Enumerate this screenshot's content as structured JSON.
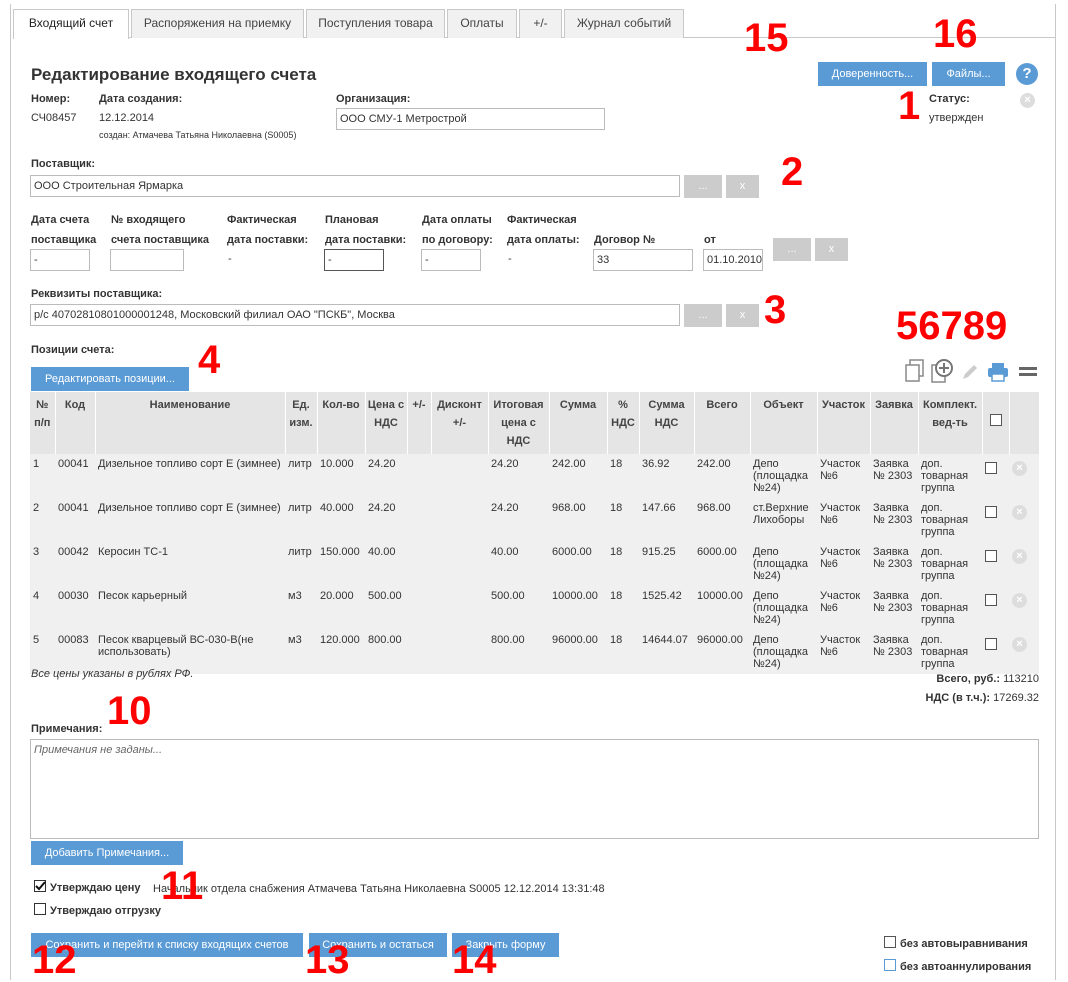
{
  "tabs": [
    "Входящий счет",
    "Распоряжения на приемку",
    "Поступления товара",
    "Оплаты",
    "+/-",
    "Журнал событий"
  ],
  "page_title": "Редактирование входящего счета",
  "header_buttons": {
    "proxy": "Доверенность...",
    "files": "Файлы...",
    "help": "?"
  },
  "header": {
    "number_label": "Номер:",
    "number": "СЧ08457",
    "created_label": "Дата создания:",
    "created": "12.12.2014",
    "created_by": "создан: Атмачева Татьяна Николаевна (S0005)",
    "org_label": "Организация:",
    "org": "ООО СМУ-1 Метрострой",
    "status_label": "Статус:",
    "status": "утвержден"
  },
  "supplier": {
    "label": "Поставщик:",
    "value": "ООО Строительная Ярмарка",
    "pick": "...",
    "clear": "x"
  },
  "dates": {
    "supplier_date_l1": "Дата счета",
    "supplier_date_l2": "поставщика",
    "supplier_date": "-",
    "incoming_no_l1": "№ входящего",
    "incoming_no_l2": "счета поставщика",
    "incoming_no": "",
    "fact_delivery_l1": "Фактическая",
    "fact_delivery_l2": "дата поставки:",
    "fact_delivery": "-",
    "plan_delivery_l1": "Плановая",
    "plan_delivery_l2": "дата поставки:",
    "plan_delivery": "-",
    "pay_contract_l1": "Дата оплаты",
    "pay_contract_l2": "по договору:",
    "pay_contract": "-",
    "fact_pay_l1": "Фактическая",
    "fact_pay_l2": "дата оплаты:",
    "fact_pay": "-",
    "contract_label": "Договор №",
    "contract": "33",
    "from_label": "от",
    "from": "01.10.2010",
    "pick": "...",
    "clear": "x"
  },
  "requisites": {
    "label": "Реквизиты поставщика:",
    "value": "р/с 40702810801000001248, Московский филиал ОАО \"ПСКБ\", Москва",
    "pick": "...",
    "clear": "x"
  },
  "positions_label": "Позиции счета:",
  "edit_positions": "Редактировать позиции...",
  "table_headers": [
    "№ п/п",
    "Код",
    "Наименование",
    "Ед. изм.",
    "Кол-во",
    "Цена с НДС",
    "+/-",
    "Дисконт +/-",
    "Итоговая цена с НДС",
    "Сумма",
    "% НДС",
    "Сумма НДС",
    "Всего",
    "Объект",
    "Участок",
    "Заявка",
    "Комплект. вед-ть"
  ],
  "rows": [
    {
      "n": "1",
      "code": "00041",
      "name": "Дизельное топливо сорт Е (зимнее)",
      "unit": "литр",
      "qty": "10.000",
      "price": "24.20",
      "pm": "",
      "disc": "",
      "final": "24.20",
      "sum": "242.00",
      "vat_pct": "18",
      "vat_sum": "36.92",
      "total": "242.00",
      "object": "Депо (площадка №24)",
      "site": "Участок №6",
      "req": "Заявка № 2303",
      "kit": "доп. товарная группа"
    },
    {
      "n": "2",
      "code": "00041",
      "name": "Дизельное топливо сорт Е (зимнее)",
      "unit": "литр",
      "qty": "40.000",
      "price": "24.20",
      "pm": "",
      "disc": "",
      "final": "24.20",
      "sum": "968.00",
      "vat_pct": "18",
      "vat_sum": "147.66",
      "total": "968.00",
      "object": "ст.Верхние Лихоборы",
      "site": "Участок №6",
      "req": "Заявка № 2303",
      "kit": "доп. товарная группа"
    },
    {
      "n": "3",
      "code": "00042",
      "name": "Керосин ТС-1",
      "unit": "литр",
      "qty": "150.000",
      "price": "40.00",
      "pm": "",
      "disc": "",
      "final": "40.00",
      "sum": "6000.00",
      "vat_pct": "18",
      "vat_sum": "915.25",
      "total": "6000.00",
      "object": "Депо (площадка №24)",
      "site": "Участок №6",
      "req": "Заявка № 2303",
      "kit": "доп. товарная группа"
    },
    {
      "n": "4",
      "code": "00030",
      "name": "Песок карьерный",
      "unit": "м3",
      "qty": "20.000",
      "price": "500.00",
      "pm": "",
      "disc": "",
      "final": "500.00",
      "sum": "10000.00",
      "vat_pct": "18",
      "vat_sum": "1525.42",
      "total": "10000.00",
      "object": "Депо (площадка №24)",
      "site": "Участок №6",
      "req": "Заявка № 2303",
      "kit": "доп. товарная группа"
    },
    {
      "n": "5",
      "code": "00083",
      "name": "Песок кварцевый ВС-030-В(не использовать)",
      "unit": "м3",
      "qty": "120.000",
      "price": "800.00",
      "pm": "",
      "disc": "",
      "final": "800.00",
      "sum": "96000.00",
      "vat_pct": "18",
      "vat_sum": "14644.07",
      "total": "96000.00",
      "object": "Депо (площадка №24)",
      "site": "Участок №6",
      "req": "Заявка № 2303",
      "kit": "доп. товарная группа"
    }
  ],
  "prices_note": "Все цены указаны в рублях РФ.",
  "totals": {
    "total_label": "Всего, руб.:",
    "total": "113210",
    "vat_label": "НДС (в т.ч.):",
    "vat": "17269.32"
  },
  "notes": {
    "label": "Примечания:",
    "placeholder": "Примечания не заданы...",
    "add": "Добавить Примечания..."
  },
  "approvals": {
    "price_label": "Утверждаю цену",
    "price_checked": true,
    "price_info": "Начальник отдела снабжения Атмачева Татьяна Николаевна S0005 12.12.2014 13:31:48",
    "ship_label": "Утверждаю отгрузку",
    "ship_checked": false
  },
  "footer_buttons": {
    "save_go": "Сохранить и перейти к списку входящих счетов",
    "save_stay": "Сохранить и остаться",
    "close": "Закрыть форму"
  },
  "options": {
    "no_autoalign": "без автовыравнивания",
    "no_autocancel": "без автоаннулирования"
  },
  "markers": [
    "1",
    "2",
    "3",
    "4",
    "56789",
    "10",
    "11",
    "12",
    "13",
    "14",
    "15",
    "16"
  ],
  "colors": {
    "accent": "#5b9bd5",
    "marker": "#ff0000",
    "grey_button": "#cccccc",
    "table_header": "#e5e5e5",
    "table_row": "#f0f0f0"
  },
  "icons": [
    "copy-icon",
    "add-copy-icon",
    "pencil-icon",
    "print-icon",
    "menu-icon",
    "help-icon",
    "remove-icon"
  ]
}
